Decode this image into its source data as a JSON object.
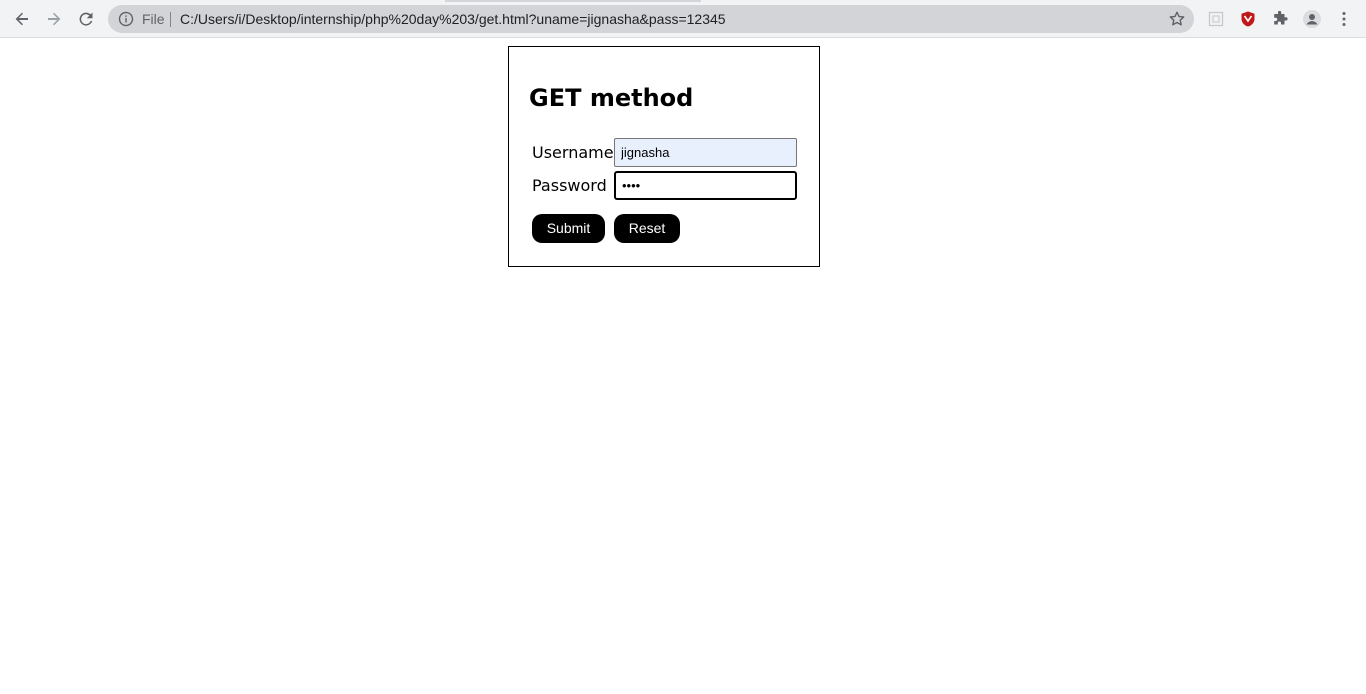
{
  "browser": {
    "scheme_label": "File",
    "url": "C:/Users/i/Desktop/internship/php%20day%203/get.html?uname=jignasha&pass=12345"
  },
  "form": {
    "title": "GET method",
    "username_label": "Username",
    "username_value": "jignasha",
    "password_label": "Password",
    "password_value": "1234",
    "submit_label": "Submit",
    "reset_label": "Reset"
  },
  "colors": {
    "toolbar_bg": "#f1f3f4",
    "omnibox_bg": "#d2d4d7",
    "autofill_bg": "#e8f0fe",
    "button_bg": "#000000",
    "button_text": "#ffffff"
  },
  "icons": {
    "back": "back-arrow-icon",
    "forward": "forward-arrow-icon",
    "reload": "reload-icon",
    "info": "info-icon",
    "bookmark": "star-icon",
    "extension_1": "extension-page-icon",
    "extension_2": "shield-extension-icon",
    "extensions_menu": "puzzle-icon",
    "profile": "profile-icon",
    "menu": "kebab-menu-icon"
  }
}
